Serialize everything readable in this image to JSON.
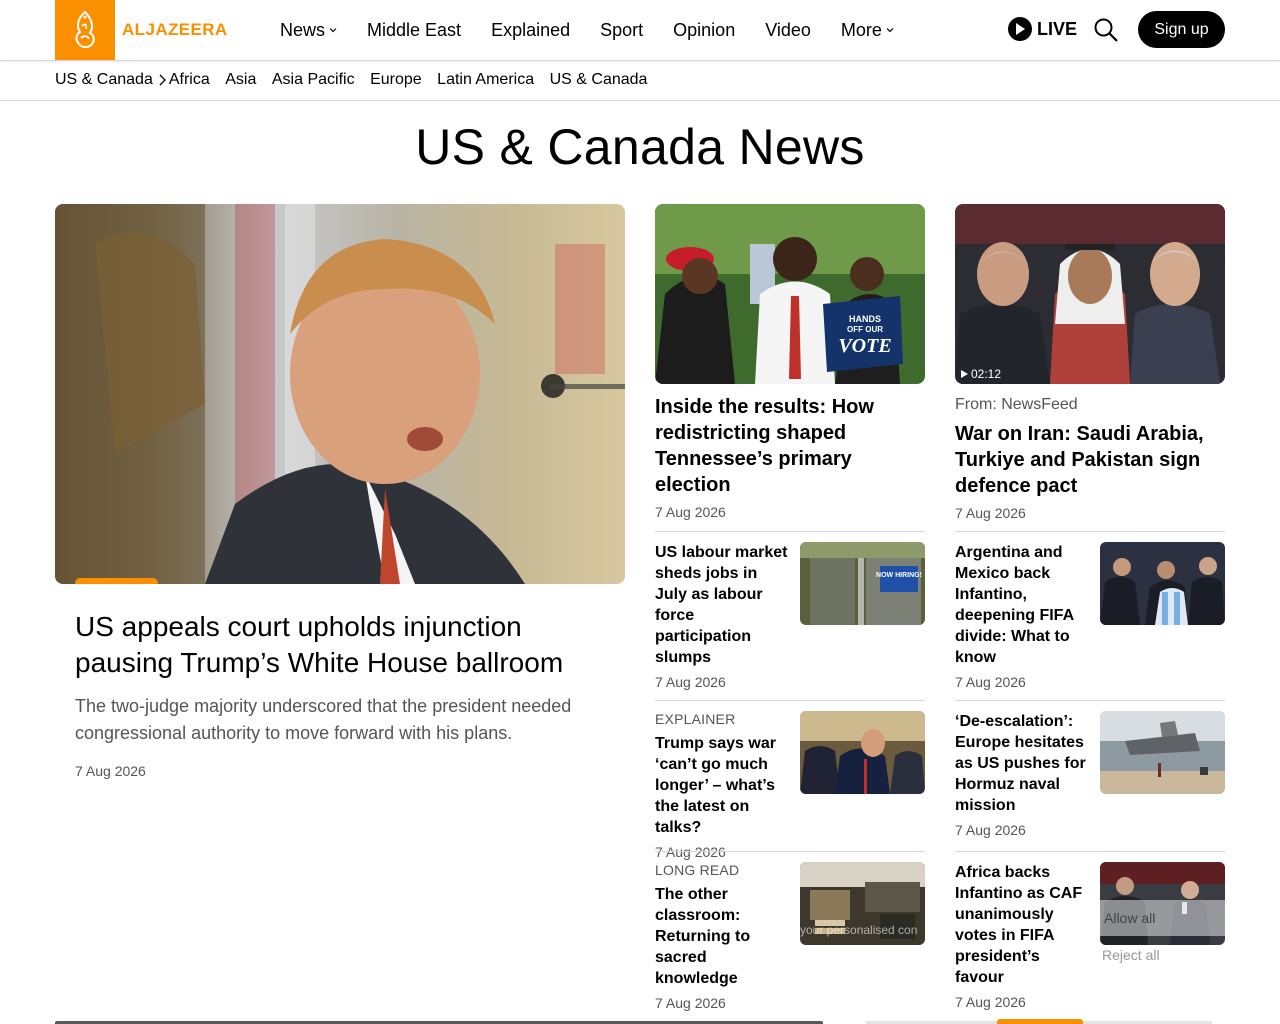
{
  "brand": {
    "name": "ALJAZEERA",
    "color": "#fa9000"
  },
  "header": {
    "nav": [
      {
        "label": "News",
        "dropdown": true
      },
      {
        "label": "Middle East",
        "dropdown": false
      },
      {
        "label": "Explained",
        "dropdown": false
      },
      {
        "label": "Sport",
        "dropdown": false
      },
      {
        "label": "Opinion",
        "dropdown": false
      },
      {
        "label": "Video",
        "dropdown": false
      },
      {
        "label": "More",
        "dropdown": true
      }
    ],
    "live_label": "LIVE",
    "signup_label": "Sign up",
    "icons": {
      "live": "play-icon",
      "search": "search-icon",
      "dropdown": "chevron-down-icon"
    }
  },
  "subnav": {
    "breadcrumb": "US & Canada",
    "items": [
      "Africa",
      "Asia",
      "Asia Pacific",
      "Europe",
      "Latin America",
      "US & Canada"
    ]
  },
  "page": {
    "title": "US & Canada News"
  },
  "featured": {
    "title": "US appeals court upholds injunction pausing Trump’s White House ballroom",
    "excerpt": "The two-judge majority underscored that the president needed congressional authority to move forward with his plans.",
    "date": "7 Aug 2026"
  },
  "top_cards": [
    {
      "title": "Inside the results: How redistricting shaped Tennessee’s primary election",
      "date": "7 Aug 2026"
    },
    {
      "source": "From: NewsFeed",
      "video_duration": "02:12",
      "title": "War on Iran: Saudi Arabia, Turkiye and Pakistan sign defence pact",
      "date": "7 Aug 2026"
    }
  ],
  "small_cards": [
    {
      "label": "",
      "title": "US labour market sheds jobs in July as labour force participation slumps",
      "date": "7 Aug 2026"
    },
    {
      "label": "",
      "title": "Argentina and Mexico back Infantino, deepening FIFA divide: What to know",
      "date": "7 Aug 2026"
    },
    {
      "label": "EXPLAINER",
      "title": "Trump says war ‘can’t go much longer’ – what’s the latest on talks?",
      "date": "7 Aug 2026"
    },
    {
      "label": "",
      "title": "‘De-escalation’: Europe hesitates as US pushes for Hormuz naval mission",
      "date": "7 Aug 2026"
    },
    {
      "label": "LONG READ",
      "title": "The other classroom: Returning to sacred knowledge",
      "date": "7 Aug 2026"
    },
    {
      "label": "",
      "title": "Africa backs Infantino as CAF unanimously votes in FIFA president’s favour",
      "date": "7 Aug 2026"
    }
  ],
  "cookie": {
    "allow_label": "Allow all",
    "reject_label": "Reject all",
    "message_fragment": "your personalised con"
  },
  "hiring_sign": {
    "text": "NOW HIRING!"
  },
  "protest_sign": {
    "line1": "HANDS",
    "line2": "OFF OUR",
    "line3": "VOTE"
  }
}
